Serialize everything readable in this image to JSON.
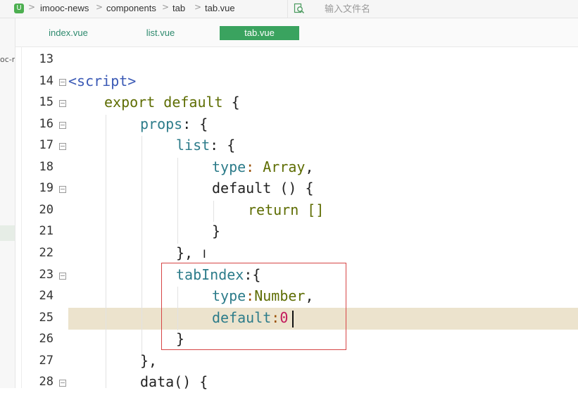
{
  "breadcrumb": {
    "app_icon": "vue-file-icon",
    "items": [
      "imooc-news",
      "components",
      "tab",
      "tab.vue"
    ],
    "separator": ">"
  },
  "search": {
    "placeholder": "输入文件名",
    "icon": "file-search-icon"
  },
  "sidebar": {
    "fragment": "oc-r"
  },
  "tabs": [
    {
      "label": "index.vue",
      "active": false
    },
    {
      "label": "list.vue",
      "active": false
    },
    {
      "label": "tab.vue",
      "active": true
    }
  ],
  "editor": {
    "active_line": 25,
    "lines": [
      {
        "n": "13"
      },
      {
        "n": "14"
      },
      {
        "n": "15"
      },
      {
        "n": "16"
      },
      {
        "n": "17"
      },
      {
        "n": "18"
      },
      {
        "n": "19"
      },
      {
        "n": "20"
      },
      {
        "n": "21"
      },
      {
        "n": "22"
      },
      {
        "n": "23"
      },
      {
        "n": "24"
      },
      {
        "n": "25"
      },
      {
        "n": "26"
      },
      {
        "n": "27"
      },
      {
        "n": "28"
      }
    ],
    "code": {
      "l14": "<script>",
      "l15_kw": "export default",
      "l15_rest": " {",
      "l16_prop": "props",
      "l16_rest": ": {",
      "l17_prop": "list",
      "l17_rest": ": {",
      "l18_prop": "type",
      "l18_colon": ":",
      "l18_type": " Array",
      "l18_rest": ",",
      "l19": "default () {",
      "l20": "return []",
      "l21": "}",
      "l22": "},",
      "l23_prop": "tabIndex",
      "l23_rest": ":{",
      "l24_prop": "type",
      "l24_colon": ":",
      "l24_type": "Number",
      "l24_rest": ",",
      "l25_prop": "default",
      "l25_colon": ":",
      "l25_num": "0",
      "l26": "}",
      "l27": "},",
      "l28": "data() {"
    }
  },
  "colors": {
    "active_tab": "#3aa35f",
    "current_line": "#ece3cd",
    "highlight_box": "#d64545"
  }
}
